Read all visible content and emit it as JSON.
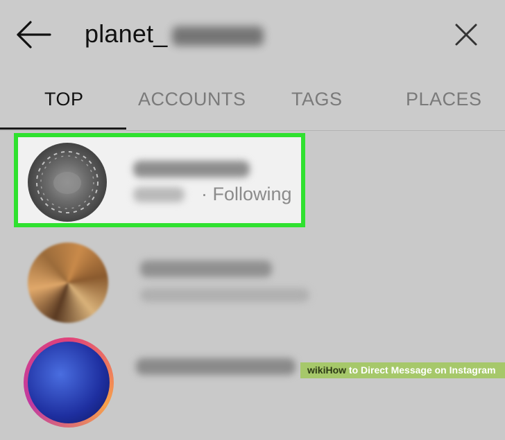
{
  "header": {
    "search_value": "planet_"
  },
  "tabs": [
    {
      "label": "TOP",
      "active": true
    },
    {
      "label": "ACCOUNTS",
      "active": false
    },
    {
      "label": "TAGS",
      "active": false
    },
    {
      "label": "PLACES",
      "active": false
    }
  ],
  "results": [
    {
      "status": "· Following",
      "highlighted": true
    },
    {
      "status": "",
      "highlighted": false
    },
    {
      "status": "",
      "highlighted": false
    }
  ],
  "colors": {
    "highlight_border": "#2fe12f",
    "background": "#c9c9c9"
  },
  "icons": {
    "back": "arrow-left-icon",
    "clear": "close-icon"
  },
  "watermark": {
    "brand": "wiki",
    "how": "How",
    "rest": " to Direct Message on Instagram"
  }
}
